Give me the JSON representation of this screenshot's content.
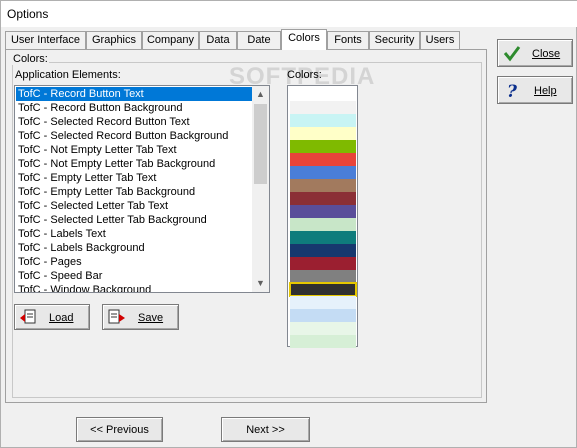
{
  "window": {
    "title": "Options"
  },
  "tabs": [
    {
      "label": "User Interface"
    },
    {
      "label": "Graphics"
    },
    {
      "label": "Company"
    },
    {
      "label": "Data"
    },
    {
      "label": "Date"
    },
    {
      "label": "Colors"
    },
    {
      "label": "Fonts"
    },
    {
      "label": "Security"
    },
    {
      "label": "Users"
    }
  ],
  "active_tab": "Colors",
  "colors_group": {
    "title": "Colors:",
    "app_elements_label": "Application Elements:",
    "colors_label": "Colors:",
    "items": [
      "TofC - Record Button Text",
      "TofC - Record Button Background",
      "TofC - Selected Record Button Text",
      "TofC - Selected Record Button Background",
      "TofC - Not Empty Letter Tab Text",
      "TofC - Not Empty Letter Tab Background",
      "TofC - Empty Letter Tab Text",
      "TofC - Empty Letter Tab Background",
      "TofC - Selected Letter Tab Text",
      "TofC - Selected Letter Tab Background",
      "TofC - Labels Text",
      "TofC - Labels Background",
      "TofC - Pages",
      "TofC - Speed Bar",
      "TofC - Window Background"
    ],
    "selected_index": 0,
    "swatches": [
      "#ffffff",
      "#f2f2f2",
      "#c8f4f4",
      "#ffffc8",
      "#7fba00",
      "#e8443a",
      "#4a7ed8",
      "#a27a5e",
      "#8b2f36",
      "#5a4e9a",
      "#c8e6c8",
      "#0f7c7c",
      "#17386e",
      "#9b1f30",
      "#808080",
      "#303030",
      "#e6f1fb",
      "#c4dcf4",
      "#e8f6e8",
      "#d6efd6"
    ],
    "selected_swatch": 15
  },
  "buttons": {
    "load": "Load",
    "save": "Save",
    "close": "Close",
    "help": "Help",
    "previous": "<< Previous",
    "next": "Next >>"
  },
  "watermark": "SOFTPEDIA"
}
